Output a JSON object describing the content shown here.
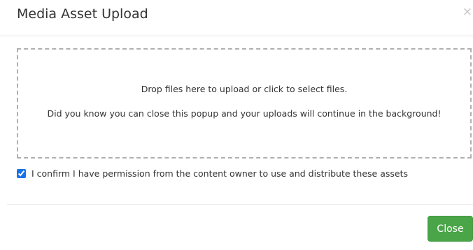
{
  "modal": {
    "title": "Media Asset Upload",
    "close_glyph": "×"
  },
  "dropzone": {
    "primary_text": "Drop files here to upload or click to select files.",
    "secondary_text": "Did you know you can close this popup and your uploads will continue in the background!"
  },
  "confirmation": {
    "checked": true,
    "label": "I confirm I have permission from the content owner to use and distribute these assets"
  },
  "footer": {
    "close_label": "Close"
  },
  "colors": {
    "accent_button": "#4aa548",
    "checkbox": "#1a73e8"
  }
}
